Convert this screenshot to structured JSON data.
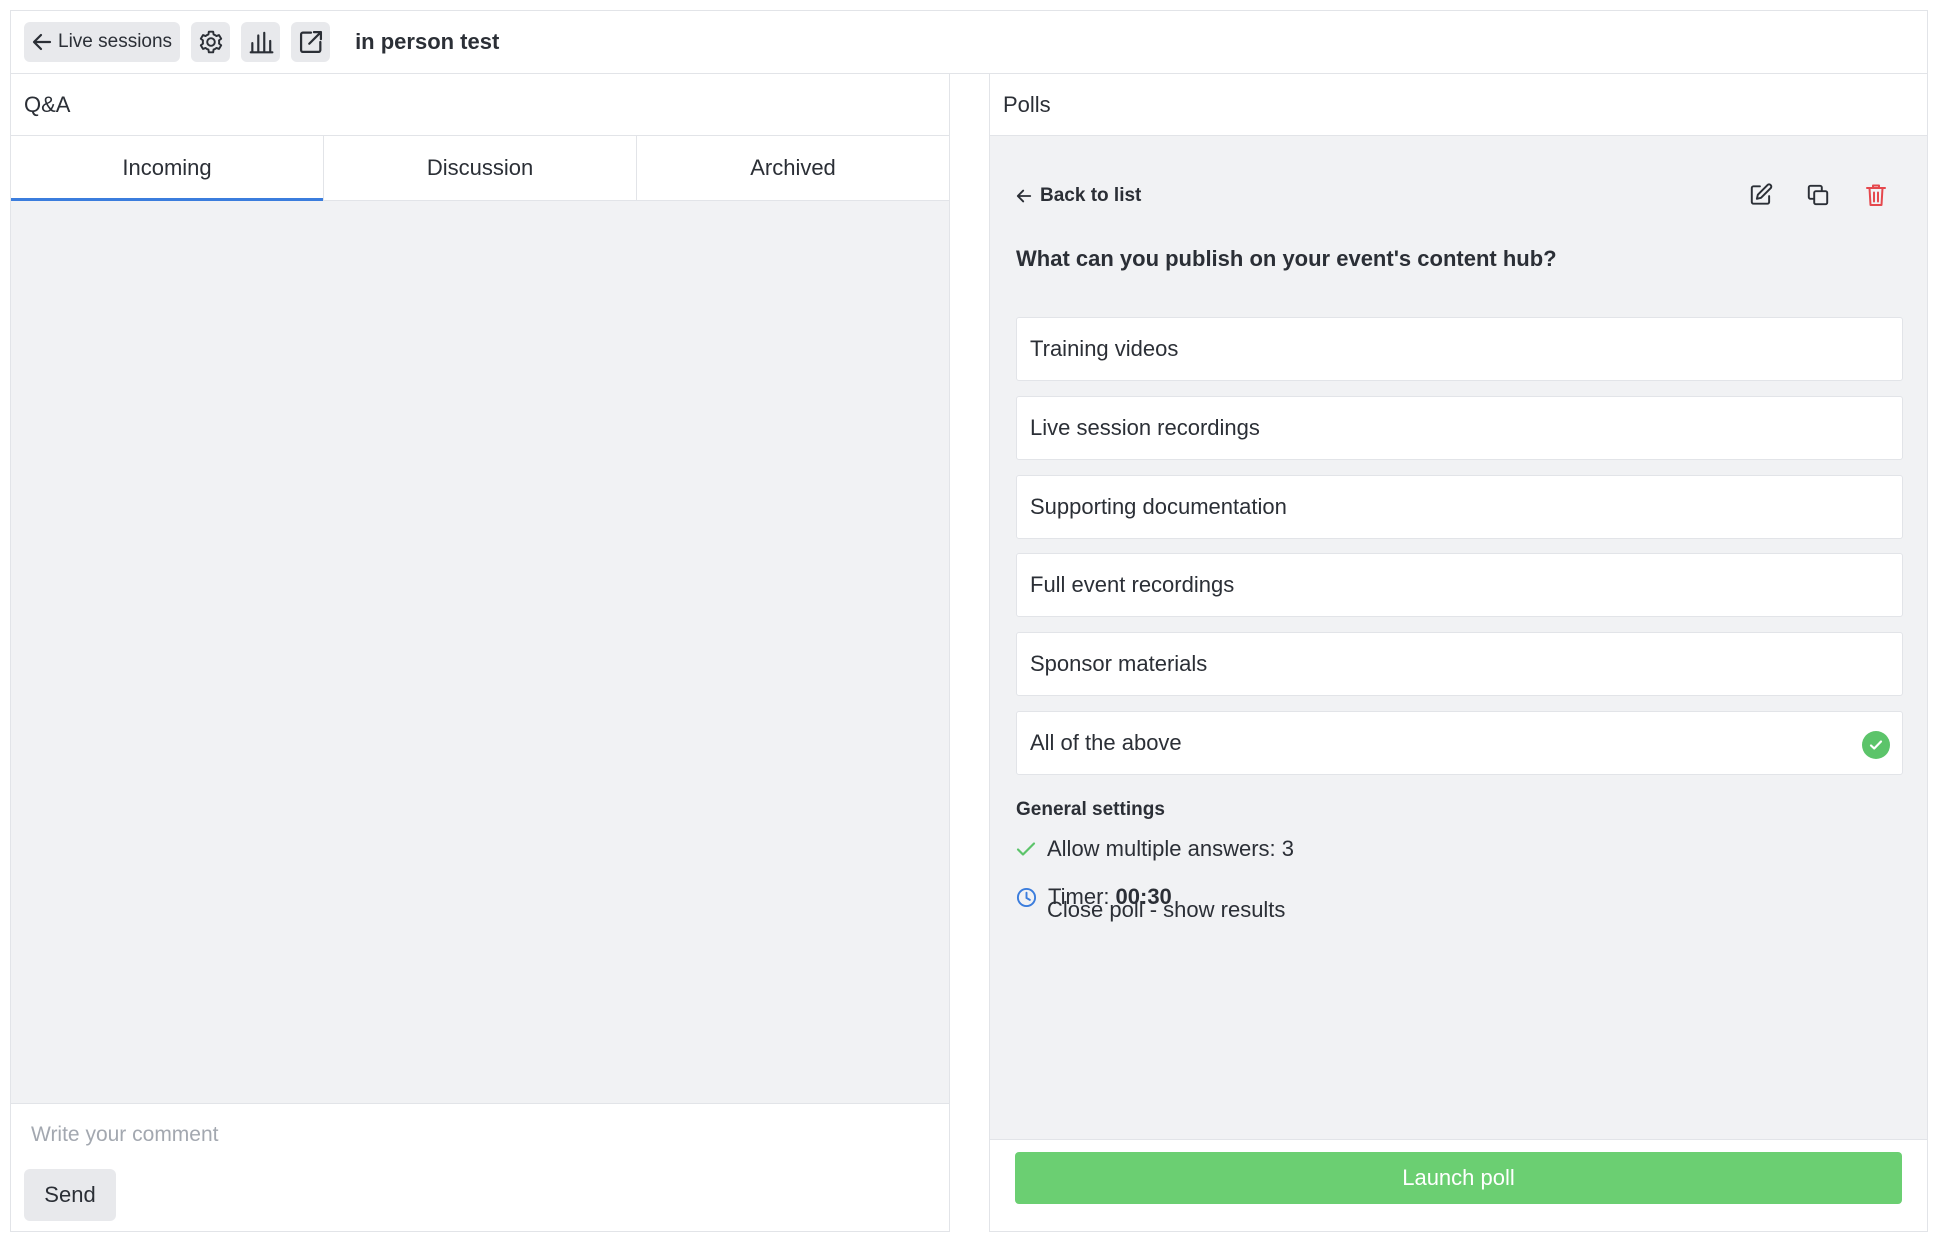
{
  "header": {
    "back_label": "Live sessions",
    "session_title": "in person test"
  },
  "qa": {
    "title": "Q&A",
    "tabs": [
      {
        "label": "Incoming",
        "active": true
      },
      {
        "label": "Discussion",
        "active": false
      },
      {
        "label": "Archived",
        "active": false
      }
    ],
    "comment_placeholder": "Write your comment",
    "send_label": "Send"
  },
  "polls": {
    "title": "Polls",
    "back_label": "Back to list",
    "question": "What can you publish on your event's content hub?",
    "options": [
      {
        "label": "Training videos",
        "correct": false
      },
      {
        "label": "Live session recordings",
        "correct": false
      },
      {
        "label": "Supporting documentation",
        "correct": false
      },
      {
        "label": "Full event recordings",
        "correct": false
      },
      {
        "label": "Sponsor materials",
        "correct": false
      },
      {
        "label": "All of the above",
        "correct": true
      }
    ],
    "settings": {
      "title": "General settings",
      "multiple_answers": "Allow multiple answers: 3",
      "timer_label": "Timer:",
      "timer_value": "00:30",
      "close_behavior": "Close poll - show results"
    },
    "launch_label": "Launch poll"
  },
  "colors": {
    "accent_blue": "#3b7ddd",
    "success_green": "#5cc46a",
    "launch_green": "#6bcf72",
    "delete_red": "#e5484d"
  },
  "icons": [
    "arrow-left-icon",
    "gear-icon",
    "bar-chart-icon",
    "external-link-icon",
    "edit-icon",
    "copy-icon",
    "trash-icon",
    "check-circle-icon",
    "check-icon",
    "clock-icon"
  ]
}
